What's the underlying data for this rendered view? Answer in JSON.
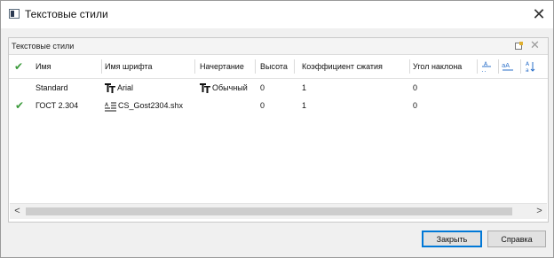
{
  "window": {
    "title": "Текстовые стили",
    "close_symbol": "✕"
  },
  "panel": {
    "title": "Текстовые стили",
    "close_symbol": "✕"
  },
  "table": {
    "columns": [
      "Имя",
      "Имя шрифта",
      "Начертание",
      "Высота",
      "Коэффициент сжатия",
      "Угол наклона"
    ],
    "rows": [
      {
        "current": false,
        "name": "Standard",
        "font": "Arial",
        "font_icon": "truetype-font-icon",
        "style": "Обычный",
        "style_icon": "truetype-style-icon",
        "height": "0",
        "width_factor": "1",
        "oblique": "0"
      },
      {
        "current": true,
        "name": "ГОСТ 2.304",
        "font": "CS_Gost2304.shx",
        "font_icon": "shx-font-icon",
        "style": "",
        "height": "0",
        "width_factor": "1",
        "oblique": "0"
      }
    ]
  },
  "icons": {
    "header_check": "checkmark-icon",
    "upside_down": "upside-down-icon",
    "backwards": "backwards-icon",
    "vertical": "vertical-text-icon",
    "new_style": "new-style-icon"
  },
  "colors": {
    "check": "#3a9a3a",
    "accent": "#0078d7"
  },
  "buttons": {
    "close": "Закрыть",
    "help": "Справка"
  }
}
